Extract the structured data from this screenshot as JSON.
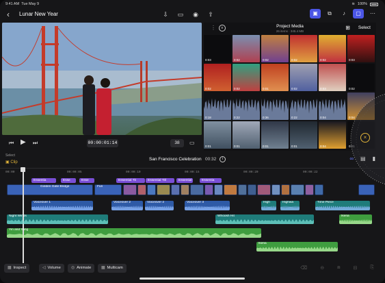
{
  "status": {
    "time": "9:41 AM",
    "date": "Tue May 9",
    "battery": "100%"
  },
  "toolbar": {
    "back_icon": "chevron-left-icon",
    "title": "Lunar New Year"
  },
  "viewer": {
    "timecode": "00:00:01:14",
    "zoom": "38"
  },
  "media": {
    "title": "Project Media",
    "subtitle": "26 items · 345.4 MB",
    "select_label": "Select",
    "tiles": [
      {
        "dur": "0:03"
      },
      {
        "dur": "0:02"
      },
      {
        "dur": "0:02"
      },
      {
        "dur": "0:02"
      },
      {
        "dur": "0:02"
      },
      {
        "dur": "0:03"
      },
      {
        "dur": "0:02"
      },
      {
        "dur": "0:02"
      },
      {
        "dur": "0:01"
      },
      {
        "dur": "0:02"
      },
      {
        "dur": "0:03"
      },
      {
        "dur": "0:02"
      },
      {
        "dur": "0:18"
      },
      {
        "dur": "0:22"
      },
      {
        "dur": "0:36"
      },
      {
        "dur": "0:22"
      },
      {
        "dur": "0:04"
      },
      {
        "dur": "0:04"
      },
      {
        "dur": "0:01"
      },
      {
        "dur": "0:01"
      },
      {
        "dur": "0:01"
      },
      {
        "dur": "0:01"
      },
      {
        "dur": "0:04"
      },
      {
        "dur": "0:01"
      }
    ]
  },
  "timeline": {
    "select_label": "Select",
    "clip_label": "Clip",
    "project_name": "San Francisco Celebration",
    "duration": "00:32",
    "ruler": [
      "00:00",
      "00:00:05",
      "00:00:10",
      "00:00:15",
      "00:00:20",
      "00:00:22"
    ],
    "titles": [
      "Essentia",
      "Esse",
      "Esse",
      "Essential Tit",
      "Essential Titl",
      "Essential Ti",
      "Essentia"
    ],
    "video_label": "Golden Gate Bridge",
    "video_label2": "Fun",
    "voiceovers": [
      "Voiceover 1",
      "Voiceover 2",
      "Voiceover 2",
      "Voiceover 3",
      "High",
      "Highwa",
      "Time Piece"
    ],
    "audio": [
      "Night Winds",
      "Whoosh Hit",
      "Ikeria",
      "Yin and Yang",
      "Ikeria"
    ]
  },
  "bottom": {
    "inspect": "Inspect",
    "volume": "Volume",
    "animate": "Animate",
    "multicam": "Multicam"
  },
  "colors": {
    "accent": "#4b56e6",
    "title": "#7a4fd6",
    "video": "#3a63b8",
    "teal": "#1f7c7a",
    "green": "#3f9d3f",
    "selected": "#e0b33a"
  }
}
